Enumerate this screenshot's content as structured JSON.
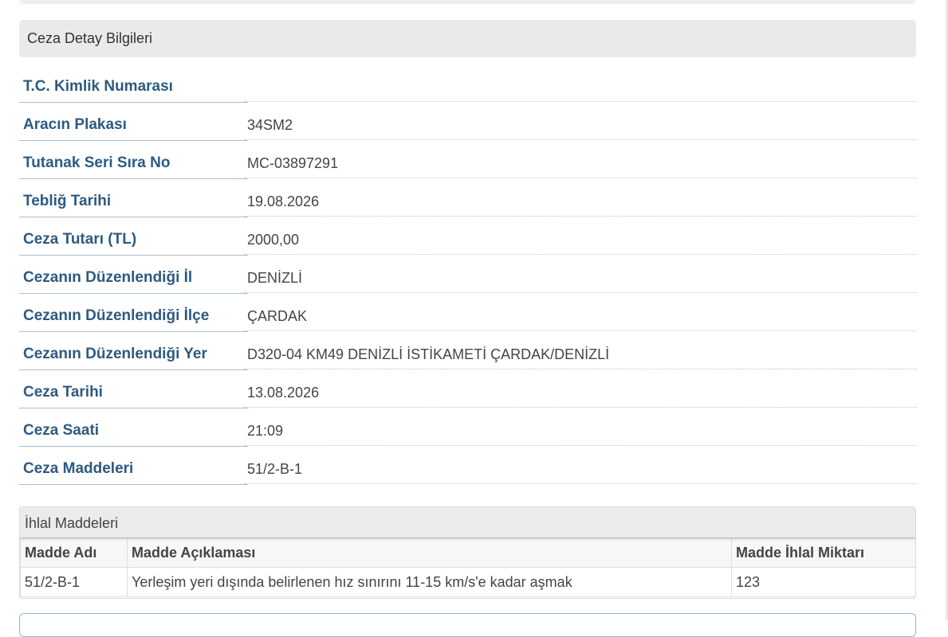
{
  "section": {
    "title": "Ceza Detay Bilgileri"
  },
  "details": [
    {
      "label": "T.C. Kimlik Numarası",
      "value": ""
    },
    {
      "label": "Aracın Plakası",
      "value": "34SM2"
    },
    {
      "label": "Tutanak Seri Sıra No",
      "value": "MC-03897291"
    },
    {
      "label": "Tebliğ Tarihi",
      "value": "19.08.2026"
    },
    {
      "label": "Ceza Tutarı (TL)",
      "value": "2000,00"
    },
    {
      "label": "Cezanın Düzenlendiği İl",
      "value": "DENİZLİ"
    },
    {
      "label": "Cezanın Düzenlendiği İlçe",
      "value": "ÇARDAK"
    },
    {
      "label": "Cezanın Düzenlendiği Yer",
      "value": "D320-04 KM49 DENİZLİ İSTİKAMETİ ÇARDAK/DENİZLİ"
    },
    {
      "label": "Ceza Tarihi",
      "value": "13.08.2026"
    },
    {
      "label": "Ceza Saati",
      "value": "21:09"
    },
    {
      "label": "Ceza Maddeleri",
      "value": "51/2-B-1"
    }
  ],
  "violations": {
    "title": "İhlal Maddeleri",
    "headers": [
      "Madde Adı",
      "Madde Açıklaması",
      "Madde İhlal Miktarı"
    ],
    "rows": [
      [
        "51/2-B-1",
        "Yerleşim yeri dışında belirlenen hız sınırını 11-15 km/s'e kadar aşmak",
        "123"
      ]
    ]
  }
}
